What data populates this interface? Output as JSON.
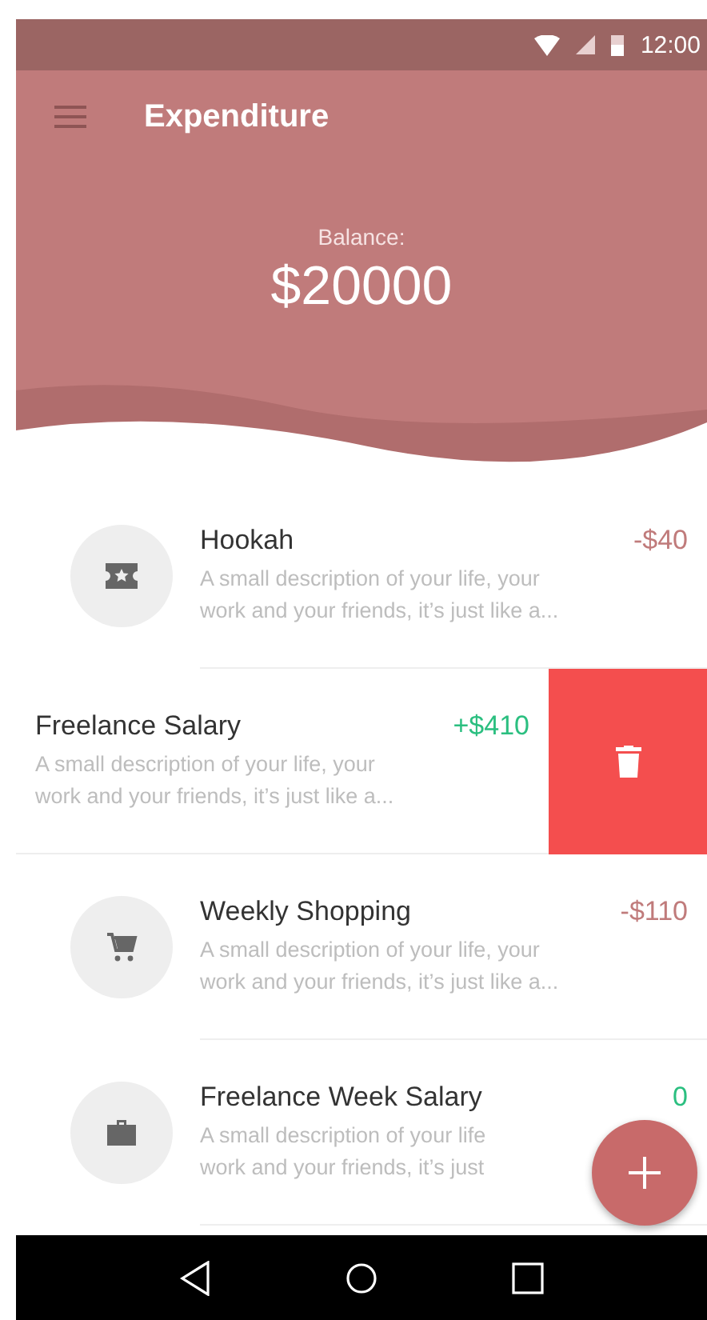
{
  "status_bar": {
    "time": "12:00"
  },
  "app_bar": {
    "title": "Expenditure"
  },
  "balance": {
    "label": "Balance:",
    "amount": "$20000"
  },
  "transactions": [
    {
      "title": "Hookah",
      "amount": "-$40",
      "color": "#c07b7b",
      "swiped": false,
      "description_lines": [
        "A small description of your life, your",
        "work and your friends, it’s just like a..."
      ]
    },
    {
      "title": "Freelance Salary",
      "amount": "+$410",
      "color": "#2bbf80",
      "swiped": true,
      "description_lines": [
        "A small description of your life, your",
        "work and your friends, it’s just like a..."
      ]
    },
    {
      "title": "Weekly Shopping",
      "amount": "-$110",
      "color": "#c07b7b",
      "swiped": false,
      "description_lines": [
        "A small description of your life, your",
        "work and your friends, it’s just like a..."
      ]
    },
    {
      "title": "Freelance Week Salary",
      "amount": "0",
      "color": "#2bbf80",
      "swiped": false,
      "description_lines": [
        "A small description of your life",
        "work and your friends, it’s just"
      ]
    }
  ]
}
